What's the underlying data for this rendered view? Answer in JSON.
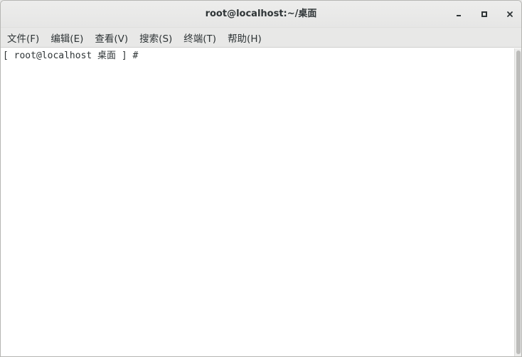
{
  "window": {
    "title": "root@localhost:~/桌面"
  },
  "menubar": {
    "items": [
      {
        "label": "文件(F)"
      },
      {
        "label": "编辑(E)"
      },
      {
        "label": "查看(V)"
      },
      {
        "label": "搜索(S)"
      },
      {
        "label": "终端(T)"
      },
      {
        "label": "帮助(H)"
      }
    ]
  },
  "terminal": {
    "prompt_line": "[ root@localhost 桌面 ] #"
  },
  "icons": {
    "minimize": "minimize-icon",
    "maximize": "maximize-icon",
    "close": "close-icon"
  },
  "colors": {
    "titlebar": "#ededec",
    "text": "#2e3436",
    "terminal_bg": "#ffffff"
  }
}
